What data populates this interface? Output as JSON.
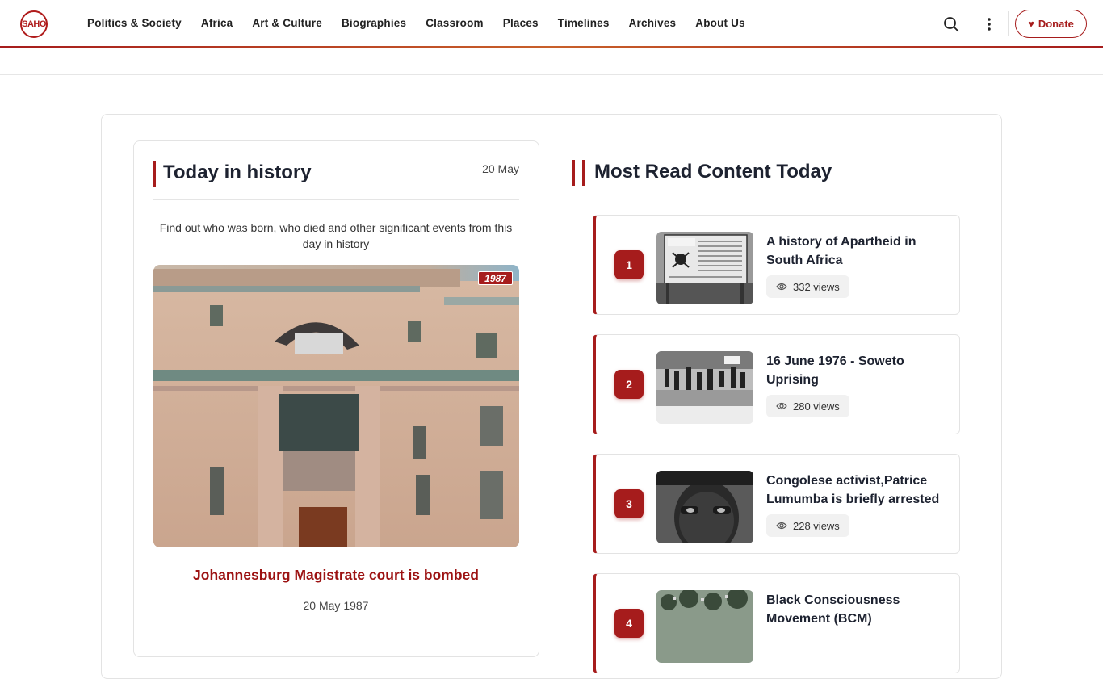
{
  "header": {
    "logo_text": "SAHO",
    "nav": [
      "Politics & Society",
      "Africa",
      "Art & Culture",
      "Biographies",
      "Classroom",
      "Places",
      "Timelines",
      "Archives",
      "About Us"
    ],
    "donate_label": "Donate",
    "donate_icon": "heart-icon",
    "accent_color": "#a61c1c"
  },
  "today": {
    "title": "Today in history",
    "date": "20 May",
    "description": "Find out who was born, who died and other significant events from this day in history",
    "year_badge": "1987",
    "event_title": "Johannesburg Magistrate court is bombed",
    "event_date": "20 May 1987"
  },
  "most_read": {
    "title": "Most Read Content Today",
    "items": [
      {
        "rank": "1",
        "title": "A history of Apartheid in South Africa",
        "views": "332 views"
      },
      {
        "rank": "2",
        "title": "16 June 1976 - Soweto Uprising",
        "views": "280 views"
      },
      {
        "rank": "3",
        "title": "Congolese activist,Patrice Lumumba is briefly arrested",
        "views": "228 views"
      },
      {
        "rank": "4",
        "title": "Black Consciousness Movement (BCM)",
        "views": ""
      }
    ]
  }
}
